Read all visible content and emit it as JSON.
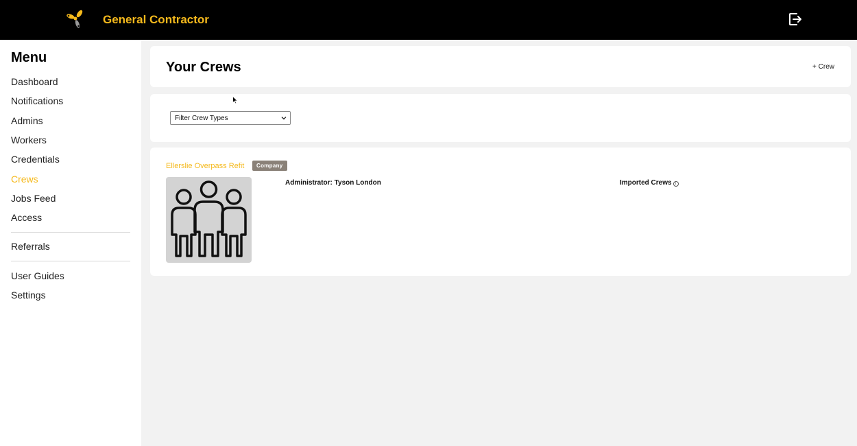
{
  "app": {
    "brand": "General Contractor",
    "logo_icon": "propeller-logo-icon",
    "accent": "#f5b91c"
  },
  "sidebar": {
    "title": "Menu",
    "items": [
      {
        "label": "Dashboard"
      },
      {
        "label": "Notifications"
      },
      {
        "label": "Admins"
      },
      {
        "label": "Workers"
      },
      {
        "label": "Credentials"
      },
      {
        "label": "Crews",
        "active": true
      },
      {
        "label": "Jobs Feed"
      },
      {
        "label": "Access"
      },
      {
        "label": "Referrals"
      },
      {
        "label": "User Guides"
      },
      {
        "label": "Settings"
      }
    ]
  },
  "header": {
    "title": "Your Crews",
    "add_label": "+ Crew"
  },
  "filter": {
    "placeholder": "Filter Crew Types"
  },
  "crew": {
    "name": "Ellerslie Overpass Refit",
    "badge": "Company",
    "administrator": "Administrator: Tyson London",
    "imported_label": "Imported Crews",
    "image_icon": "crew-people-icon"
  }
}
